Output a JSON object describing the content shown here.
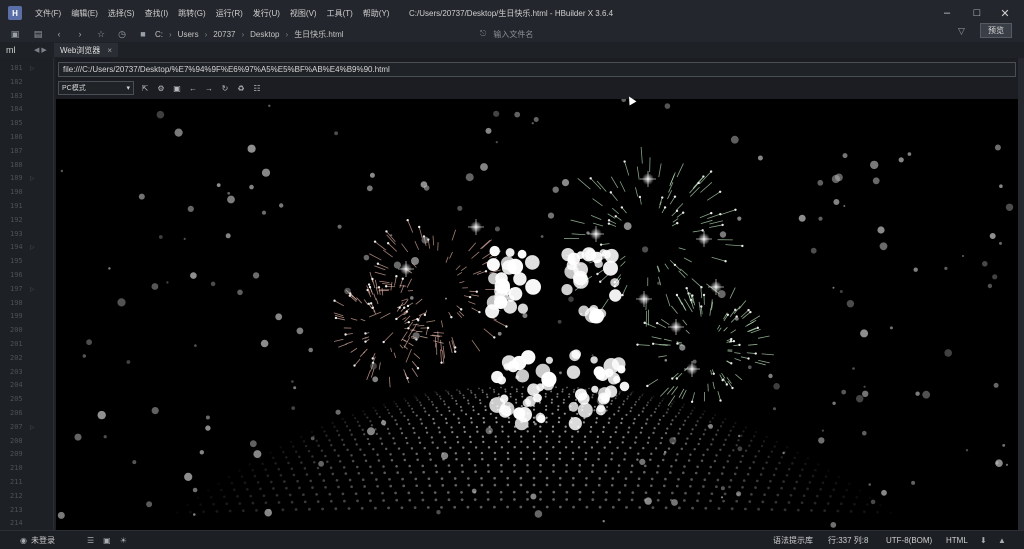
{
  "app": {
    "logo_text": "H",
    "menu": [
      "文件(F)",
      "编辑(E)",
      "选择(S)",
      "查找(I)",
      "跳转(G)",
      "运行(R)",
      "发行(U)",
      "视图(V)",
      "工具(T)",
      "帮助(Y)"
    ],
    "window_title": "C:/Users/20737/Desktop/生日快乐.html - HBuilder X 3.6.4"
  },
  "toolbar": {
    "breadcrumb": [
      "C:",
      "Users",
      "20737",
      "Desktop",
      "生日快乐.html"
    ],
    "file_search_placeholder": "输入文件名",
    "preview_label": "预览"
  },
  "tabs": {
    "left_label": "ml",
    "active_tab": "Web浏览器",
    "close_glyph": "×"
  },
  "gutter": {
    "line_numbers": [
      "181",
      "182",
      "183",
      "184",
      "185",
      "186",
      "187",
      "188",
      "189",
      "190",
      "191",
      "192",
      "193",
      "194",
      "195",
      "196",
      "197",
      "198",
      "199",
      "200",
      "201",
      "202",
      "203",
      "204",
      "205",
      "206",
      "207",
      "208",
      "209",
      "210",
      "211",
      "212",
      "213",
      "214"
    ]
  },
  "browser": {
    "url": "file:///C:/Users/20737/Desktop/%E7%94%9F%E6%97%A5%E5%BF%AB%E4%B9%90.html",
    "mode_selected": "PC模式"
  },
  "status": {
    "login": "未登录",
    "syntax_hint": "语法提示库",
    "position": "行:337  列:8",
    "encoding": "UTF-8(BOM)",
    "language": "HTML"
  },
  "colors": {
    "canvas_bg": "#000000",
    "chrome_bg": "#23262c",
    "particle": "#b4b4b4"
  }
}
